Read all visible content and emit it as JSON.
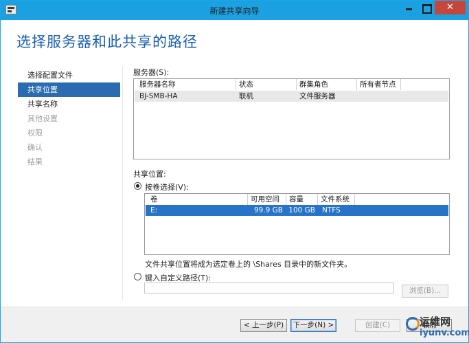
{
  "window": {
    "title": "新建共享向导"
  },
  "page_title": "选择服务器和此共享的路径",
  "steps": [
    {
      "label": "选择配置文件",
      "state": "normal"
    },
    {
      "label": "共享位置",
      "state": "active"
    },
    {
      "label": "共享名称",
      "state": "normal"
    },
    {
      "label": "其他设置",
      "state": "disabled"
    },
    {
      "label": "权限",
      "state": "disabled"
    },
    {
      "label": "确认",
      "state": "disabled"
    },
    {
      "label": "结果",
      "state": "disabled"
    }
  ],
  "servers": {
    "label": "服务器(S):",
    "columns": [
      "服务器名称",
      "状态",
      "群集角色",
      "所有者节点"
    ],
    "rows": [
      {
        "name": "BJ-SMB-HA",
        "status": "联机",
        "role": "文件服务器",
        "owner": ""
      }
    ]
  },
  "share_location": {
    "label": "共享位置:",
    "by_volume_label": "按卷选择(V):",
    "by_volume_checked": true,
    "columns": [
      "卷",
      "可用空间",
      "容量",
      "文件系统"
    ],
    "rows": [
      {
        "volume": "E:",
        "free": "99.9 GB",
        "capacity": "100 GB",
        "fs": "NTFS"
      }
    ],
    "note": "文件共享位置将成为选定卷上的 \\Shares 目录中的新文件夹。",
    "custom_path_label": "键入自定义路径(T):",
    "custom_path_value": "",
    "browse_label": "浏览(B)..."
  },
  "buttons": {
    "previous": "< 上一步(P)",
    "next": "下一步(N) >",
    "create": "创建(C)",
    "cancel": "取消"
  },
  "watermark": {
    "top": "运维网",
    "bottom": "iyunv.com"
  }
}
